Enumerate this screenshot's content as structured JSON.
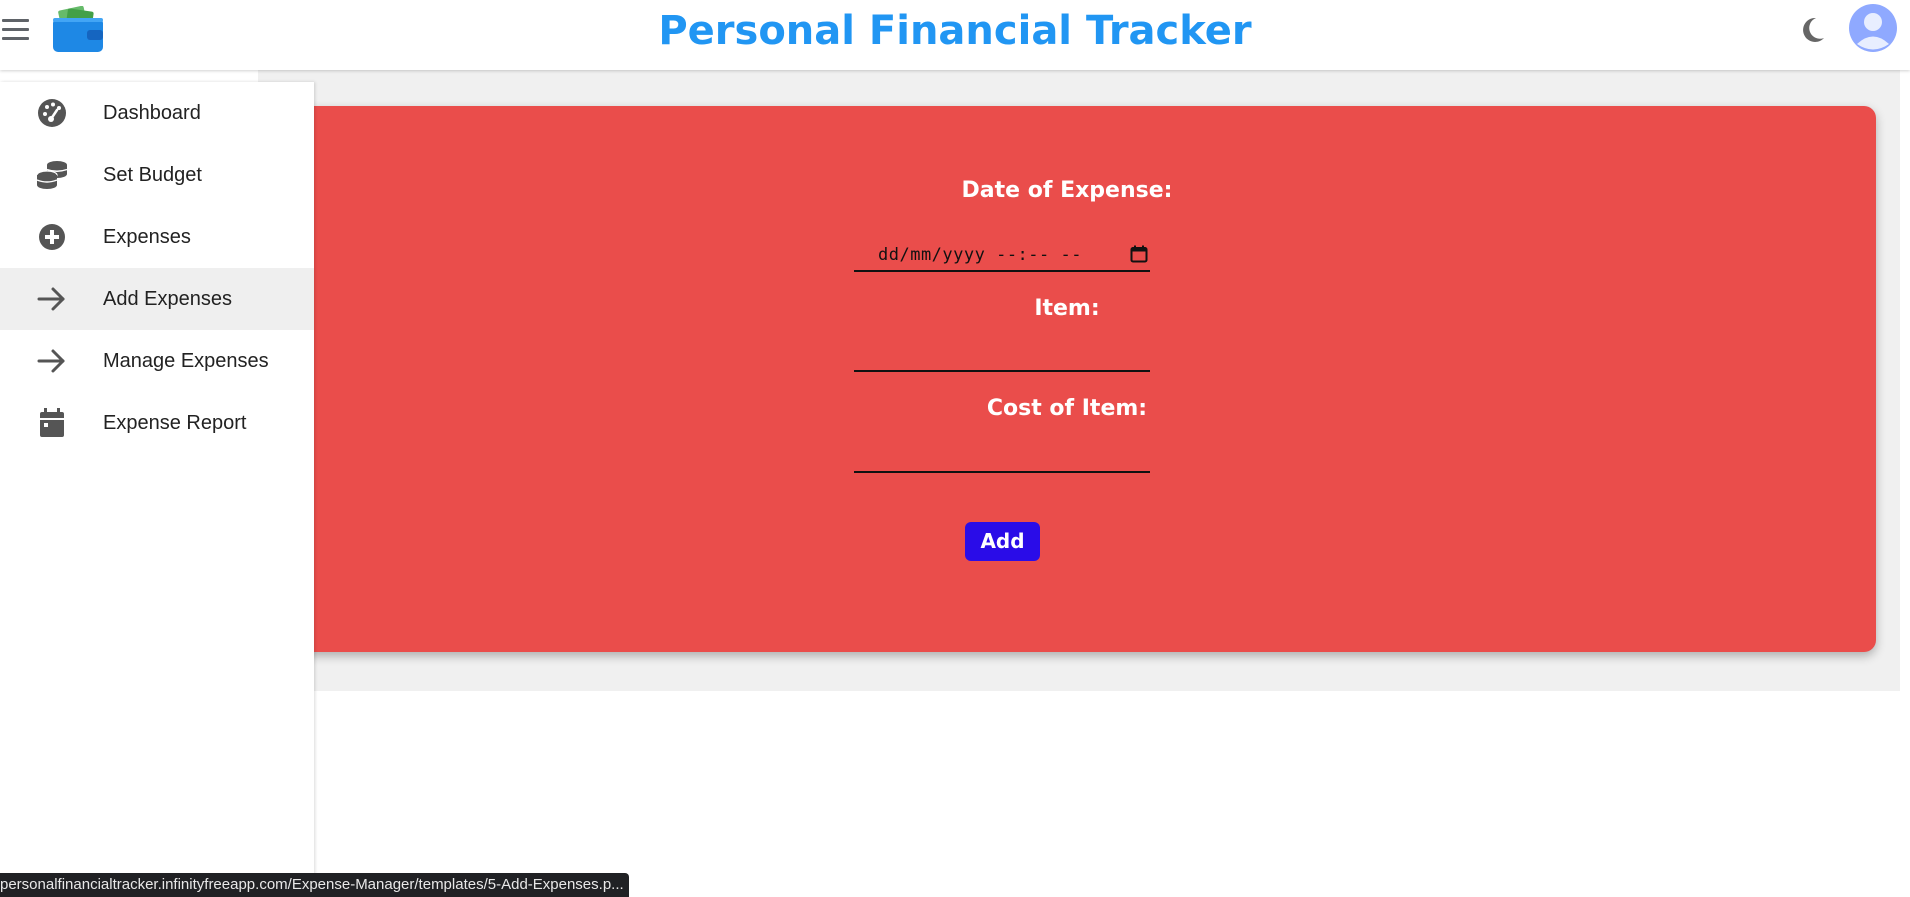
{
  "header": {
    "title": "Personal Financial Tracker",
    "menu_icon": "hamburger-menu-icon",
    "logo_icon": "wallet-icon",
    "theme_icon": "moon-icon",
    "avatar_icon": "user-avatar-icon",
    "title_color": "#2196f3"
  },
  "sidebar": {
    "items": [
      {
        "label": "Dashboard",
        "icon": "dashboard-gauge-icon",
        "active": false
      },
      {
        "label": "Set Budget",
        "icon": "coins-icon",
        "active": false
      },
      {
        "label": "Expenses",
        "icon": "plus-circle-icon",
        "active": false
      },
      {
        "label": "Add Expenses",
        "icon": "arrow-right-icon",
        "active": true
      },
      {
        "label": "Manage Expenses",
        "icon": "arrow-right-icon",
        "active": false
      },
      {
        "label": "Expense Report",
        "icon": "calendar-icon",
        "active": false
      }
    ]
  },
  "form": {
    "date_label": "Date of Expense:",
    "date_placeholder": "dd/mm/yyyy --:-- --",
    "item_label": "Item:",
    "item_value": "",
    "cost_label": "Cost of Item:",
    "cost_value": "",
    "add_button": "Add",
    "card_color": "#ea4d4b",
    "button_color": "#2a0ce8"
  },
  "statusbar": {
    "url": "personalfinancialtracker.infinityfreeapp.com/Expense-Manager/templates/5-Add-Expenses.p..."
  }
}
